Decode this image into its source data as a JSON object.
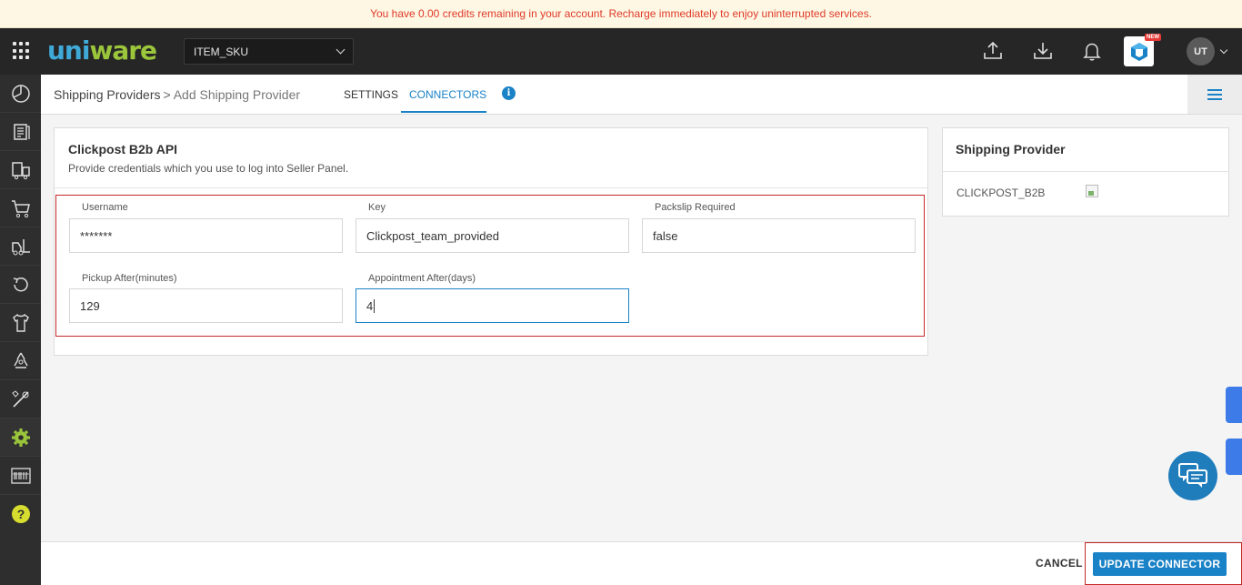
{
  "banner": {
    "text": "You have 0.00 credits remaining in your account. Recharge immediately to enjoy uninterrupted services."
  },
  "header": {
    "logo_text_part1": "uni",
    "logo_text_part2": "ware",
    "facility_select": {
      "value": "ITEM_SKU"
    },
    "new_badge": "NEW",
    "user_initials": "UT"
  },
  "sidebar": {
    "items": [
      "dashboard-icon",
      "orders-icon",
      "shipping-icon",
      "cart-icon",
      "forklift-icon",
      "returns-icon",
      "products-icon",
      "recycle-icon",
      "tools-icon",
      "settings-icon",
      "barcode-icon",
      "help-icon"
    ]
  },
  "subheader": {
    "breadcrumb_root": "Shipping Providers",
    "breadcrumb_separator": ">",
    "breadcrumb_current": "Add Shipping Provider",
    "tabs": [
      {
        "label": "SETTINGS",
        "active": false
      },
      {
        "label": "CONNECTORS",
        "active": true
      }
    ],
    "info_icon": "i"
  },
  "connector": {
    "title": "Clickpost B2b API",
    "subtitle": "Provide credentials which you use to log into Seller Panel.",
    "fields": [
      {
        "label": "Username",
        "value": "*******"
      },
      {
        "label": "Key",
        "value": "Clickpost_team_provided"
      },
      {
        "label": "Packslip Required",
        "value": "false"
      },
      {
        "label": "Pickup After(minutes)",
        "value": "129"
      },
      {
        "label": "Appointment After(days)",
        "value": "4"
      }
    ]
  },
  "shipping_provider": {
    "title": "Shipping Provider",
    "code": "CLICKPOST_B2B"
  },
  "footer": {
    "cancel_label": "CANCEL",
    "update_label": "UPDATE CONNECTOR"
  },
  "colors": {
    "accent": "#1a82c6",
    "banner_text": "#e03a2b",
    "highlight_border": "#c62828",
    "logo_blue": "#3fa9d8",
    "logo_green": "#9bc63b"
  }
}
